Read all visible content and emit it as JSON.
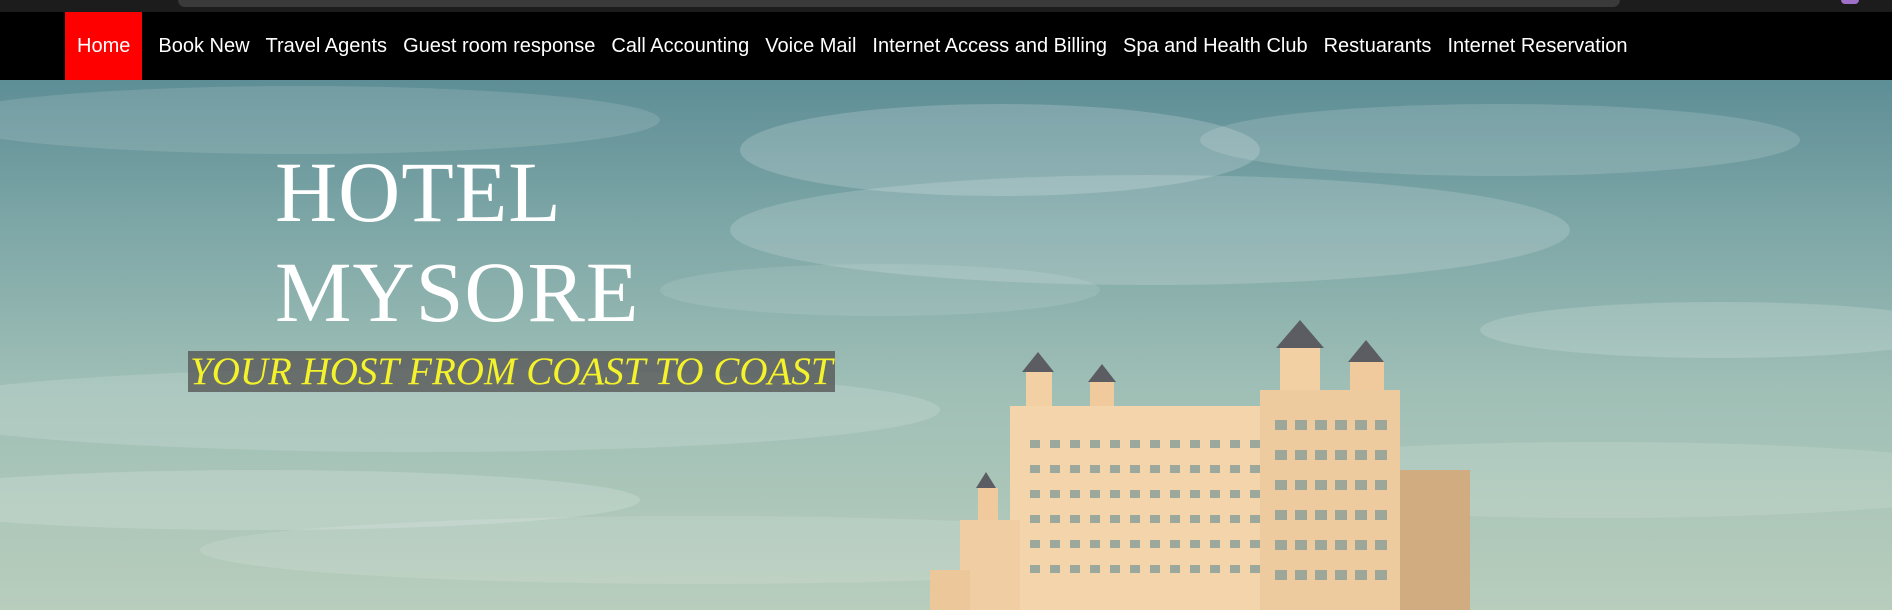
{
  "nav": {
    "items": [
      {
        "label": "Home",
        "active": true
      },
      {
        "label": "Book New"
      },
      {
        "label": "Travel Agents"
      },
      {
        "label": "Guest room response"
      },
      {
        "label": "Call Accounting"
      },
      {
        "label": "Voice Mail"
      },
      {
        "label": "Internet Access and Billing"
      },
      {
        "label": "Spa and Health Club"
      },
      {
        "label": "Restuarants"
      },
      {
        "label": "Internet Reservation"
      }
    ],
    "active_color": "#ff0000",
    "background": "#000000"
  },
  "hero": {
    "title_line1": "HOTEL",
    "title_line2": "MYSORE",
    "tagline": "YOUR HOST FROM COAST TO COAST",
    "tagline_color": "#f4f22a",
    "image": "hotel-building-sky"
  }
}
